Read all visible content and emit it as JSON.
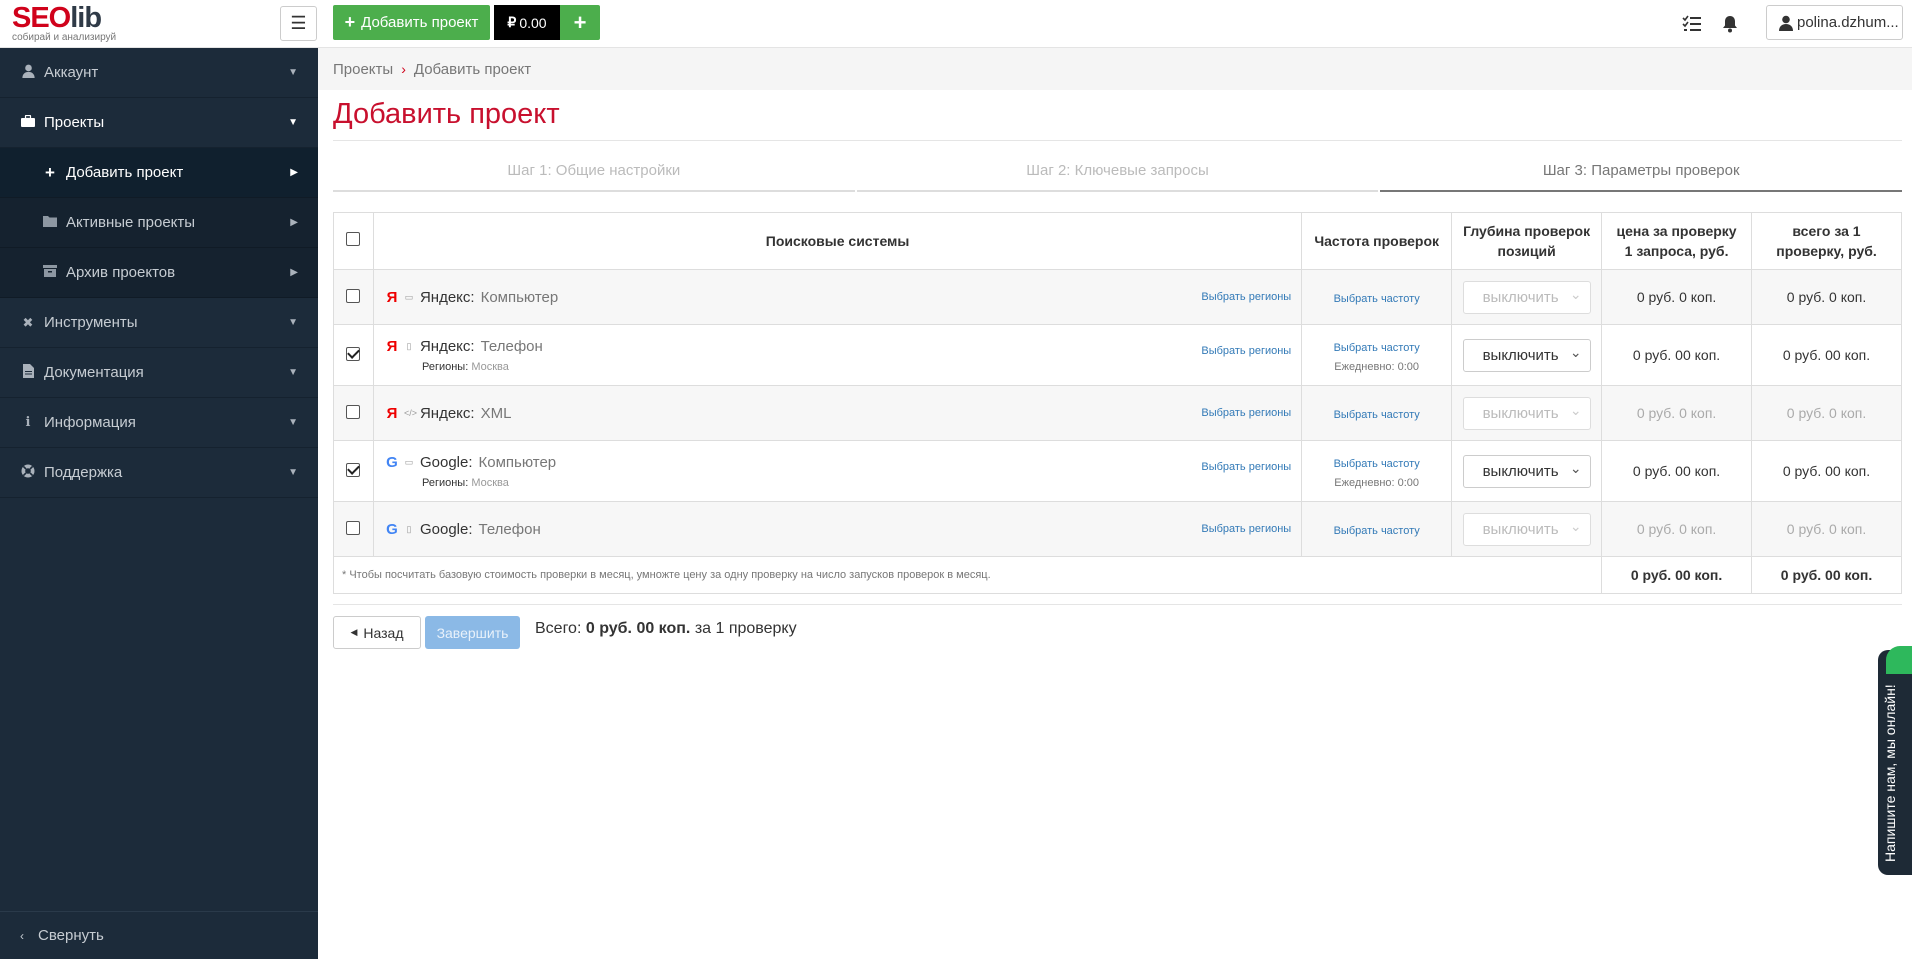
{
  "app": {
    "logo_seo": "SEO",
    "logo_lib": "lib",
    "logo_tagline": "собирай и анализируй"
  },
  "topbar": {
    "add_project_label": "Добавить проект",
    "balance_label": "0.00",
    "plus_label": "+",
    "user_label": "polina.dzhum..."
  },
  "sidebar": {
    "items": [
      {
        "label": "Аккаунт",
        "icon": "user-icon"
      },
      {
        "label": "Проекты",
        "icon": "briefcase-icon"
      },
      {
        "label": "Добавить проект",
        "icon": "plus-icon"
      },
      {
        "label": "Активные проекты",
        "icon": "folder-icon"
      },
      {
        "label": "Архив проектов",
        "icon": "archive-icon"
      },
      {
        "label": "Инструменты",
        "icon": "tools-icon"
      },
      {
        "label": "Документация",
        "icon": "file-icon"
      },
      {
        "label": "Информация",
        "icon": "info-icon"
      },
      {
        "label": "Поддержка",
        "icon": "lifebuoy-icon"
      }
    ],
    "collapse_label": "Свернуть"
  },
  "breadcrumb": {
    "root": "Проекты",
    "current": "Добавить проект"
  },
  "page": {
    "title": "Добавить проект"
  },
  "steps": [
    {
      "label": "Шаг 1: Общие настройки"
    },
    {
      "label": "Шаг 2: Ключевые запросы"
    },
    {
      "label": "Шаг 3: Параметры проверок"
    }
  ],
  "table": {
    "headers": {
      "engines": "Поисковые системы",
      "frequency": "Частота проверок",
      "depth": "Глубина проверок позиций",
      "price_per": "цена за проверку 1 запроса, руб.",
      "total_per": "всего за 1 проверку, руб."
    },
    "rows": [
      {
        "engine": "Яндекс:",
        "device": "Компьютер",
        "logo": "Я",
        "checked": false,
        "region_label": "",
        "region_value": "",
        "regions_link": "Выбрать регионы",
        "freq_link": "Выбрать частоту",
        "freq_sub": "",
        "depth": "выключить",
        "price": "0 руб. 0 коп.",
        "total": "0 руб. 0 коп."
      },
      {
        "engine": "Яндекс:",
        "device": "Телефон",
        "logo": "Я",
        "checked": true,
        "region_label": "Регионы:",
        "region_value": "Москва",
        "regions_link": "Выбрать регионы",
        "freq_link": "Выбрать частоту",
        "freq_sub": "Ежедневно: 0:00",
        "depth": "выключить",
        "price": "0 руб. 00 коп.",
        "total": "0 руб. 00 коп."
      },
      {
        "engine": "Яндекс:",
        "device": "XML",
        "logo": "Я",
        "checked": false,
        "region_label": "",
        "region_value": "",
        "regions_link": "Выбрать регионы",
        "freq_link": "Выбрать частоту",
        "freq_sub": "",
        "depth": "выключить",
        "price": "0 руб. 0 коп.",
        "total": "0 руб. 0 коп."
      },
      {
        "engine": "Google:",
        "device": "Компьютер",
        "logo": "G",
        "checked": true,
        "region_label": "Регионы:",
        "region_value": "Москва",
        "regions_link": "Выбрать регионы",
        "freq_link": "Выбрать частоту",
        "freq_sub": "Ежедневно: 0:00",
        "depth": "выключить",
        "price": "0 руб. 00 коп.",
        "total": "0 руб. 00 коп."
      },
      {
        "engine": "Google:",
        "device": "Телефон",
        "logo": "G",
        "checked": false,
        "region_label": "",
        "region_value": "",
        "regions_link": "Выбрать регионы",
        "freq_link": "Выбрать частоту",
        "freq_sub": "",
        "depth": "выключить",
        "price": "0 руб. 0 коп.",
        "total": "0 руб. 0 коп."
      }
    ],
    "footnote": "* Чтобы посчитать базовую стоимость проверки в месяц, умножте цену за одну проверку на число запусков проверок в месяц.",
    "footer_price": "0 руб. 00 коп.",
    "footer_total": "0 руб. 00 коп."
  },
  "actions": {
    "back_label": "Назад",
    "finish_label": "Завершить",
    "total_prefix": "Всего:",
    "total_value": "0 руб. 00 коп.",
    "total_suffix": "за 1 проверку"
  },
  "chat": {
    "label": "Напишите нам, мы онлайн!"
  },
  "colors": {
    "accent_red": "#c8102e",
    "green": "#4cae4c",
    "sidebar": "#1c2b3a",
    "link": "#337ab7"
  }
}
